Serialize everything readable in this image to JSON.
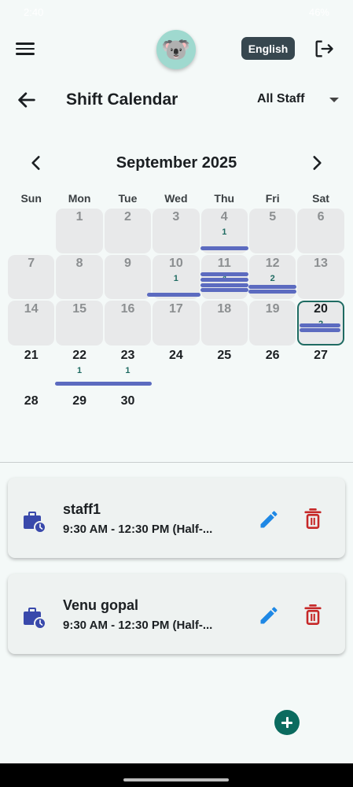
{
  "status_bar": {
    "time": "2:40",
    "battery": "46%"
  },
  "top_bar": {
    "language": "English",
    "avatar_glyph": "🐨"
  },
  "header": {
    "title": "Shift Calendar",
    "staff_filter": "All Staff"
  },
  "calendar": {
    "month_label": "September 2025",
    "weekdays": [
      "Sun",
      "Mon",
      "Tue",
      "Wed",
      "Thu",
      "Fri",
      "Sat"
    ],
    "today": 20,
    "weeks": [
      [
        null,
        1,
        2,
        3,
        4,
        5,
        6
      ],
      [
        7,
        8,
        9,
        10,
        11,
        12,
        13
      ],
      [
        14,
        15,
        16,
        17,
        18,
        19,
        20
      ],
      [
        21,
        22,
        23,
        24,
        25,
        26,
        27
      ],
      [
        28,
        29,
        30,
        null,
        null,
        null,
        null
      ]
    ],
    "past_through": 19,
    "shift_counts": {
      "4": 1,
      "10": 1,
      "11": 4,
      "12": 2,
      "20": 2,
      "22": 1,
      "23": 1
    }
  },
  "shifts": [
    {
      "name": "staff1",
      "time": "9:30 AM - 12:30 PM (Half-..."
    },
    {
      "name": "Venu gopal",
      "time": "9:30 AM - 12:30 PM (Half-..."
    }
  ],
  "colors": {
    "accent": "#1f6b62",
    "shift_bar": "#5c6bc0",
    "edit": "#1e88e5",
    "delete": "#c62828",
    "briefcase": "#3949ab"
  }
}
